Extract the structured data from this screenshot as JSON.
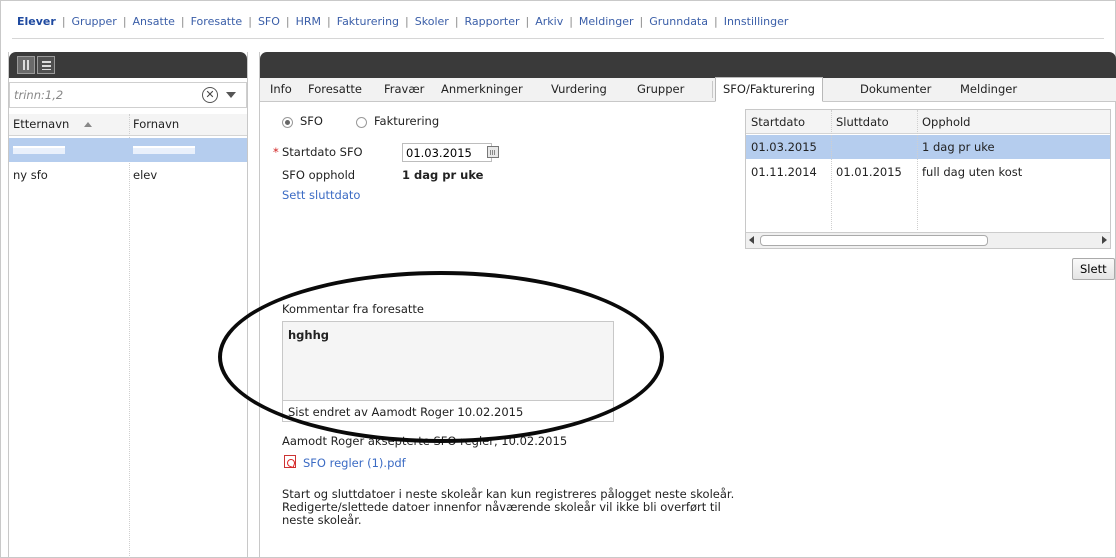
{
  "nav": {
    "items": [
      "Elever",
      "Grupper",
      "Ansatte",
      "Foresatte",
      "SFO",
      "HRM",
      "Fakturering",
      "Skoler",
      "Rapporter",
      "Arkiv",
      "Meldinger",
      "Grunndata",
      "Innstillinger"
    ],
    "active": "Elever"
  },
  "left": {
    "filter_value": "trinn:1,2",
    "columns": [
      "Etternavn",
      "Fornavn"
    ],
    "rows": [
      {
        "etternavn": "",
        "fornavn": "",
        "selected": true
      },
      {
        "etternavn": "ny sfo",
        "fornavn": "elev",
        "selected": false
      }
    ]
  },
  "tabs": [
    "Info",
    "Foresatte",
    "Fravær",
    "Anmerkninger",
    "Vurdering",
    "Grupper",
    "SFO/Fakturering",
    "Dokumenter",
    "Meldinger"
  ],
  "active_tab": "SFO/Fakturering",
  "form": {
    "radio_sfo": "SFO",
    "radio_fakturering": "Fakturering",
    "required_mark": "*",
    "startdato_label": "Startdato SFO",
    "startdato_value": "01.03.2015",
    "opphold_label": "SFO opphold",
    "opphold_value": "1 dag pr uke",
    "sett_sluttdato": "Sett sluttdato"
  },
  "history": {
    "columns": [
      "Startdato",
      "Sluttdato",
      "Opphold"
    ],
    "rows": [
      {
        "start": "01.03.2015",
        "slutt": "",
        "opphold": "1 dag pr uke",
        "selected": true
      },
      {
        "start": "01.11.2014",
        "slutt": "01.01.2015",
        "opphold": "full dag uten kost",
        "selected": false
      }
    ],
    "delete_label": "Slett"
  },
  "comment": {
    "label": "Kommentar fra foresatte",
    "text": "hghhg",
    "last_changed": "Sist endret av Aamodt Roger 10.02.2015"
  },
  "accepted_text": "Aamodt Roger aksepterte SFO regler, 10.02.2015",
  "pdf_link": "SFO regler (1).pdf",
  "note": "Start og sluttdatoer i neste skoleår kan kun registreres pålogget neste skoleår. Redigerte/slettede datoer innenfor nåværende skoleår vil ikke bli overført til neste skoleår.",
  "icons": {
    "clear": "clear-circle-icon",
    "dropdown": "chevron-down-icon",
    "sort": "sort-ascending-icon",
    "calendar": "calendar-icon",
    "pdf": "pdf-icon"
  },
  "colors": {
    "selected_row": "#b5cdee",
    "link": "#3b6bc4",
    "header_bar": "#3a3a3a"
  }
}
